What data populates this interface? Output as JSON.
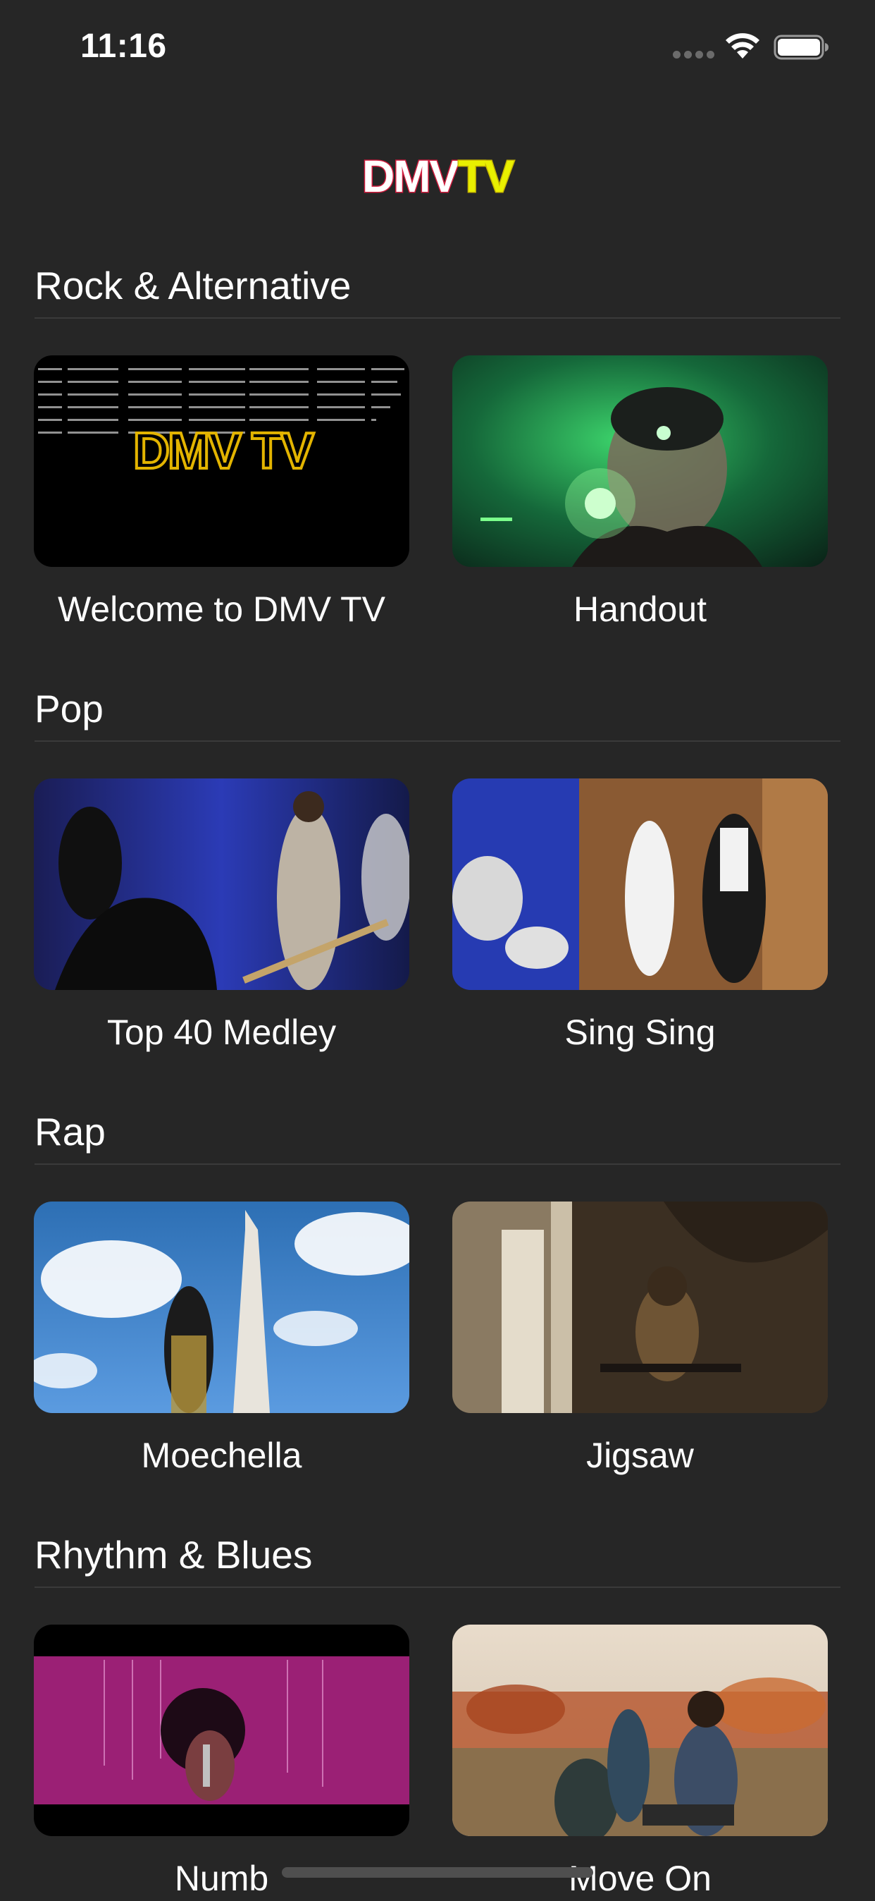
{
  "status_bar": {
    "time": "11:16"
  },
  "logo": {
    "dmv": "DMV",
    "tv": "TV",
    "dmv_color": "#d11d3f",
    "tv_color": "#e9f000"
  },
  "sections": [
    {
      "title": "Rock & Alternative",
      "videos": [
        {
          "title": "Welcome to DMV TV",
          "thumbnail": "dmv-tv-logo-thumbnail",
          "thumbnail_text": "DMV TV"
        },
        {
          "title": "Handout",
          "thumbnail": "singer-green-light-thumbnail"
        }
      ]
    },
    {
      "title": "Pop",
      "videos": [
        {
          "title": "Top 40 Medley",
          "thumbnail": "band-on-stage-thumbnail"
        },
        {
          "title": "Sing Sing",
          "thumbnail": "horn-section-thumbnail"
        }
      ]
    },
    {
      "title": "Rap",
      "videos": [
        {
          "title": "Moechella",
          "thumbnail": "washington-monument-thumbnail"
        },
        {
          "title": "Jigsaw",
          "thumbnail": "cathedral-thumbnail"
        }
      ]
    },
    {
      "title": "Rhythm & Blues",
      "videos": [
        {
          "title": "Numb",
          "thumbnail": "pink-stage-singer-thumbnail"
        },
        {
          "title": "Move On",
          "thumbnail": "autumn-field-trio-thumbnail"
        }
      ]
    }
  ]
}
